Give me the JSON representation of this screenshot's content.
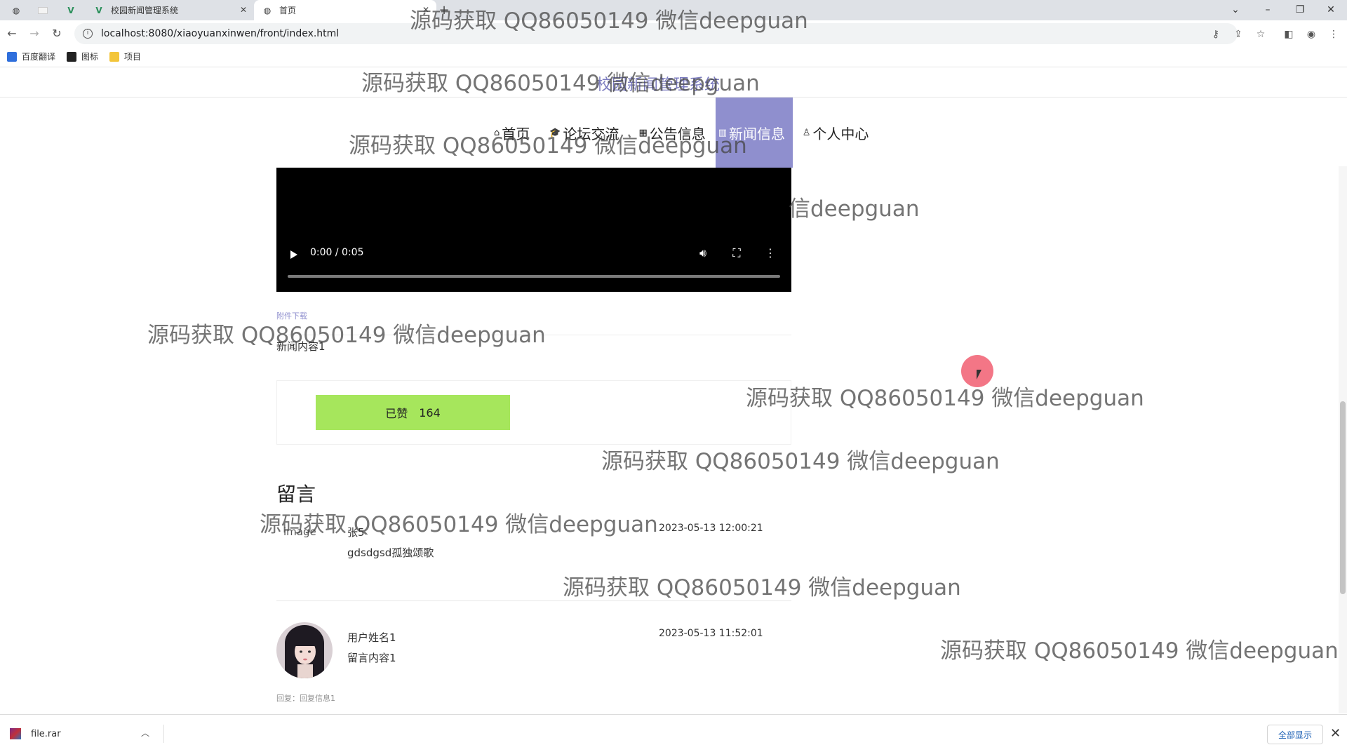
{
  "browser": {
    "tabs": [
      {
        "title": "校园新闻管理系统"
      },
      {
        "title": "首页"
      }
    ],
    "new_tab_glyph": "+",
    "url": "localhost:8080/xiaoyuanxinwen/front/index.html",
    "bookmarks": [
      "百度翻译",
      "图标",
      "项目"
    ]
  },
  "site": {
    "title": "校园新闻管理系统",
    "menu": [
      {
        "label": "首页",
        "icon": "home-icon",
        "glyph": "⌂"
      },
      {
        "label": "论坛交流",
        "icon": "graduation-cap-icon",
        "glyph": "🎓"
      },
      {
        "label": "公告信息",
        "icon": "notice-icon",
        "glyph": "▦"
      },
      {
        "label": "新闻信息",
        "icon": "news-icon",
        "glyph": "▥",
        "active": true
      },
      {
        "label": "个人中心",
        "icon": "user-icon",
        "glyph": "♙"
      }
    ]
  },
  "video": {
    "time": "0:00 / 0:05"
  },
  "news": {
    "attachment_label": "附件下载",
    "content": "新闻内容1",
    "like_label": "已赞",
    "like_count": "164"
  },
  "messages": {
    "title": "留言",
    "items": [
      {
        "name": "张5",
        "text": "gdsdgsd孤独颂歌",
        "time": "2023-05-13 12:00:21",
        "avatar_alt": "image"
      },
      {
        "name": "用户姓名1",
        "text": "留言内容1",
        "time": "2023-05-13 11:52:01",
        "reply": "回复：回复信息1"
      }
    ]
  },
  "watermark": "源码获取 QQ86050149 微信deepguan",
  "watermark_partial": "信deepguan",
  "download": {
    "filename": "file.rar",
    "show_all": "全部显示"
  },
  "colors": {
    "accent": "#8f8fce",
    "like_button": "#a6e65c",
    "cursor": "#f05064"
  }
}
